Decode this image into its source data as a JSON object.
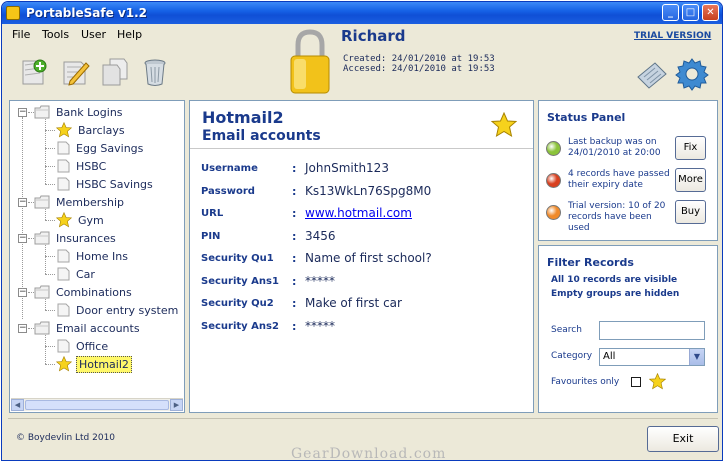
{
  "window": {
    "title": "PortableSafe v1.2"
  },
  "menu": [
    "File",
    "Tools",
    "User",
    "Help"
  ],
  "header": {
    "user": "Richard",
    "trial_label": "TRIAL VERSION",
    "created": "Created: 24/01/2010 at 19:53",
    "accessed": "Accesed: 24/01/2010 at 19:53"
  },
  "toolbar_icons": [
    "add-record-icon",
    "edit-record-icon",
    "copy-record-icon",
    "delete-record-icon",
    "padlock-icon",
    "keyboard-icon",
    "settings-gear-icon"
  ],
  "tree": {
    "groups": [
      {
        "label": "Bank Logins",
        "items": [
          {
            "label": "Barclays",
            "fav": true
          },
          {
            "label": "Egg Savings",
            "fav": false
          },
          {
            "label": "HSBC",
            "fav": false
          },
          {
            "label": "HSBC Savings",
            "fav": false
          }
        ]
      },
      {
        "label": "Membership",
        "items": [
          {
            "label": "Gym",
            "fav": true
          }
        ]
      },
      {
        "label": "Insurances",
        "items": [
          {
            "label": "Home Ins",
            "fav": false
          },
          {
            "label": "Car",
            "fav": false
          }
        ]
      },
      {
        "label": "Combinations",
        "items": [
          {
            "label": "Door entry system",
            "fav": false
          }
        ]
      },
      {
        "label": "Email accounts",
        "items": [
          {
            "label": "Office",
            "fav": false
          },
          {
            "label": "Hotmail2",
            "fav": true,
            "selected": true
          }
        ]
      }
    ]
  },
  "detail": {
    "title": "Hotmail2",
    "subtitle": "Email accounts",
    "fields": [
      {
        "label": "Username",
        "value": "JohnSmith123"
      },
      {
        "label": "Password",
        "value": "Ks13WkLn76Spg8M0"
      },
      {
        "label": "URL",
        "value": "www.hotmail.com",
        "link": true
      },
      {
        "label": "PIN",
        "value": "3456"
      },
      {
        "label": "Security Qu1",
        "value": "Name of first school?"
      },
      {
        "label": "Security Ans1",
        "value": "*****"
      },
      {
        "label": "Security Qu2",
        "value": "Make of first car"
      },
      {
        "label": "Security Ans2",
        "value": "*****"
      }
    ]
  },
  "status_panel": {
    "title": "Status Panel",
    "items": [
      {
        "text": "Last backup was on 24/01/2010 at 20:00",
        "button": "Fix",
        "color": "#8bc33a"
      },
      {
        "text": "4 records have passed their expiry date",
        "button": "More",
        "color": "#d8401f"
      },
      {
        "text": "Trial version: 10 of 20 records have been used",
        "button": "Buy",
        "color": "#f08a2a"
      }
    ]
  },
  "filter": {
    "title": "Filter Records",
    "visible_info": "All 10 records are visible",
    "empty_info": "Empty groups are hidden",
    "search_label": "Search",
    "search_value": "",
    "category_label": "Category",
    "category_value": "All",
    "favourites_label": "Favourites only",
    "favourites_checked": false
  },
  "footer": {
    "copyright": "© Boydevlin Ltd 2010",
    "exit_label": "Exit",
    "watermark": "GearDownload.com"
  }
}
